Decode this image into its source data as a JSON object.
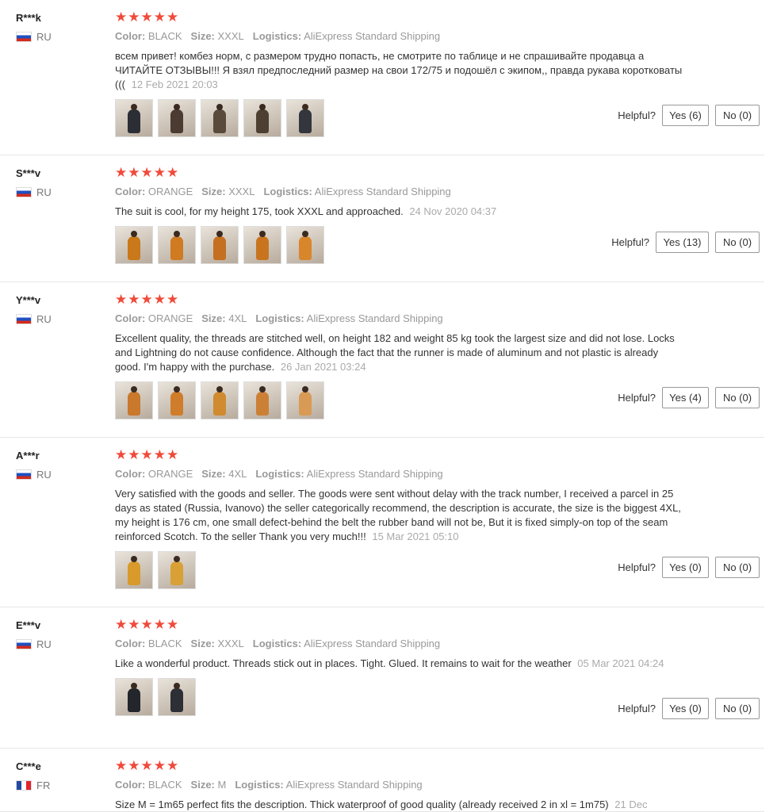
{
  "labels": {
    "color": "Color:",
    "size": "Size:",
    "logistics": "Logistics:",
    "helpful": "Helpful?"
  },
  "reviews": [
    {
      "user": "R***k",
      "country": "RU",
      "stars": "★★★★★",
      "color": "BLACK",
      "size": "XXXL",
      "logistics": "AliExpress Standard Shipping",
      "text": "всем привет! комбез норм, с размером трудно попасть, не смотрите по таблице и не спрашивайте продавца а ЧИТАЙТЕ ОТЗЫВЫ!!! Я взял предпоследний размер на свои 172/75 и подошёл с экипом,, правда рукава коротковаты (((",
      "date": "12 Feb 2021 20:03",
      "photo_colors": [
        "#2b2e35",
        "#4b3b30",
        "#5a4a3c",
        "#4e3f33",
        "#33363d"
      ],
      "yes": "Yes (6)",
      "no": "No (0)"
    },
    {
      "user": "S***v",
      "country": "RU",
      "stars": "★★★★★",
      "color": "ORANGE",
      "size": "XXXL",
      "logistics": "AliExpress Standard Shipping",
      "text": "The suit is cool, for my height 175, took XXXL and approached.",
      "date": "24 Nov 2020 04:37",
      "photo_colors": [
        "#c9781a",
        "#d07a22",
        "#c47020",
        "#c8741f",
        "#d8862c"
      ],
      "yes": "Yes (13)",
      "no": "No (0)"
    },
    {
      "user": "Y***v",
      "country": "RU",
      "stars": "★★★★★",
      "color": "ORANGE",
      "size": "4XL",
      "logistics": "AliExpress Standard Shipping",
      "text": "Excellent quality, the threads are stitched well, on height 182 and weight 85 kg took the largest size and did not lose. Locks and Lightning do not cause confidence. Although the fact that the runner is made of aluminum and not plastic is already good. I'm happy with the purchase.",
      "date": "26 Jan 2021 03:24",
      "photo_colors": [
        "#c9782c",
        "#cf7d2a",
        "#d08a30",
        "#cc8036",
        "#d99a55"
      ],
      "yes": "Yes (4)",
      "no": "No (0)"
    },
    {
      "user": "A***r",
      "country": "RU",
      "stars": "★★★★★",
      "color": "ORANGE",
      "size": "4XL",
      "logistics": "AliExpress Standard Shipping",
      "text": "Very satisfied with the goods and seller. The goods were sent without delay with the track number, I received a parcel in 25 days as stated (Russia, Ivanovo) the seller categorically recommend, the description is accurate, the size is the biggest 4XL, my height is 176 cm, one small defect-behind the belt the rubber band will not be, But it is fixed simply-on top of the seam reinforced Scotch. To the seller Thank you very much!!!",
      "date": "15 Mar 2021 05:10",
      "photo_colors": [
        "#d89a2a",
        "#d9a036"
      ],
      "yes": "Yes (0)",
      "no": "No (0)"
    },
    {
      "user": "E***v",
      "country": "RU",
      "stars": "★★★★★",
      "color": "BLACK",
      "size": "XXXL",
      "logistics": "AliExpress Standard Shipping",
      "text": "Like a wonderful product. Threads stick out in places. Tight. Glued. It remains to wait for the weather",
      "date": "05 Mar 2021 04:24",
      "photo_colors": [
        "#23262b",
        "#2c2f36"
      ],
      "yes": "Yes (0)",
      "no": "No (0)"
    },
    {
      "user": "C***e",
      "country": "FR",
      "stars": "★★★★★",
      "color": "BLACK",
      "size": "M",
      "logistics": "AliExpress Standard Shipping",
      "text": "Size M = 1m65 perfect fits the description. Thick waterproof of good quality (already received 2 in xl = 1m75)",
      "date": "21 Dec",
      "photo_colors": [],
      "yes": "",
      "no": ""
    }
  ]
}
